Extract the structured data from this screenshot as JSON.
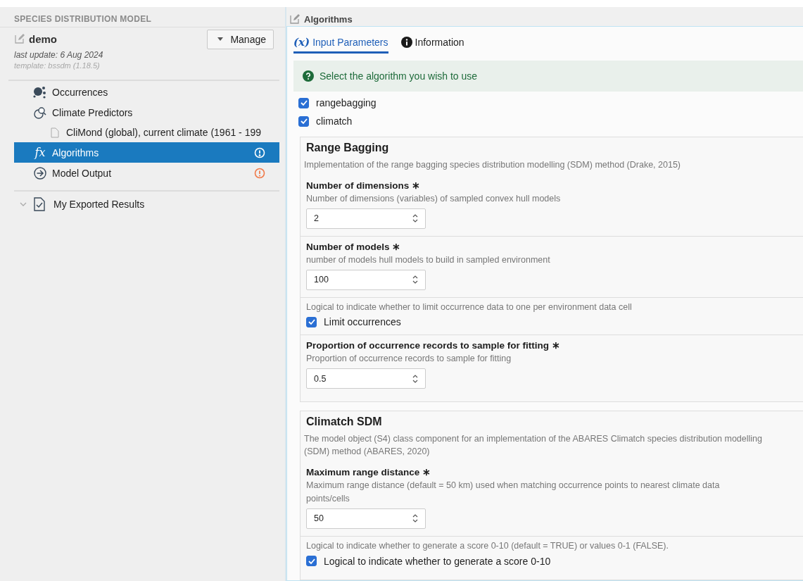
{
  "sidebar": {
    "heading": "SPECIES DISTRIBUTION MODEL",
    "project": {
      "name": "demo",
      "last_update": "last update: 6 Aug 2024",
      "template": "template: bssdm (1.18.5)"
    },
    "manage_button": "Manage",
    "items": [
      {
        "kind": "occurrences",
        "label": "Occurrences",
        "selected": false
      },
      {
        "kind": "predictors",
        "label": "Climate Predictors",
        "selected": false,
        "children": [
          {
            "label": "CliMond (global), current climate (1961 - 199",
            "selected": false
          }
        ]
      },
      {
        "kind": "algorithms",
        "glyph": "fx",
        "label": "Algorithms",
        "selected": true,
        "alert": true
      },
      {
        "kind": "output",
        "label": "Model Output",
        "selected": false,
        "alert": true
      }
    ],
    "exported": {
      "label": "My Exported Results"
    }
  },
  "panel": {
    "title": "Algorithms",
    "tabs": [
      {
        "kind": "params",
        "glyph": "(x)",
        "label": "Input Parameters",
        "selected": true
      },
      {
        "kind": "info",
        "label": "Information",
        "selected": false
      }
    ],
    "hint": "Select the algorithm you wish to use",
    "algorithms": [
      {
        "label": "rangebagging",
        "checked": true
      },
      {
        "label": "climatch",
        "checked": true
      }
    ],
    "sections": [
      {
        "title": "Range Bagging",
        "description": "Implementation of the range bagging species distribution modelling (SDM) method (Drake, 2015)",
        "params": [
          {
            "kind": "number",
            "label": "Number of dimensions ∗",
            "description": "Number of dimensions (variables) of sampled convex hull models",
            "value": "2"
          },
          {
            "kind": "number",
            "label": "Number of models ∗",
            "description": "number of models hull models to build in sampled environment",
            "value": "100"
          },
          {
            "kind": "checkbox",
            "description": "Logical to indicate whether to limit occurrence data to one per environment data cell",
            "label": "Limit occurrences",
            "checked": true
          },
          {
            "kind": "number",
            "label": "Proportion of occurrence records to sample for fitting ∗",
            "description": "Proportion of occurrence records to sample for fitting",
            "value": "0.5"
          }
        ]
      },
      {
        "title": "Climatch SDM",
        "description": "The model object (S4) class component for an implementation of the ABARES Climatch species distribution modelling (SDM) method (ABARES, 2020)",
        "params": [
          {
            "kind": "number",
            "label": "Maximum range distance ∗",
            "description": "Maximum range distance (default = 50 km) used when matching occurrence points to nearest climate data points/cells",
            "value": "50"
          },
          {
            "kind": "checkbox",
            "description": "Logical to indicate whether to generate a score 0-10 (default = TRUE) or values 0-1 (FALSE).",
            "label": "Logical to indicate whether to generate a score 0-10",
            "checked": true
          }
        ]
      }
    ]
  }
}
